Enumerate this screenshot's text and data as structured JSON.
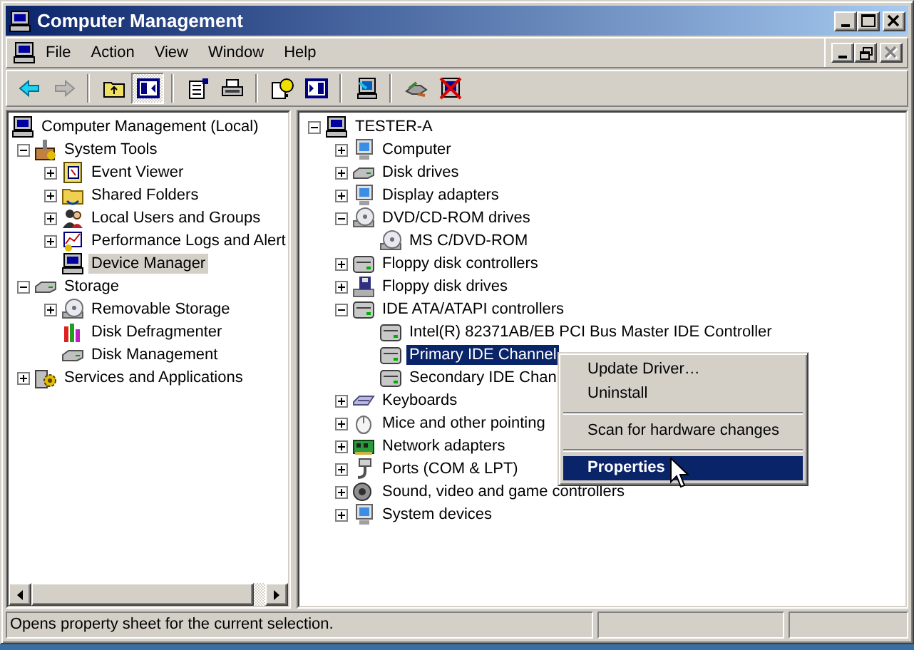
{
  "window": {
    "title": "Computer Management",
    "buttons": [
      {
        "kind": "minimize"
      },
      {
        "kind": "maximize"
      },
      {
        "kind": "close"
      }
    ]
  },
  "menu_bar": {
    "items": [
      "File",
      "Action",
      "View",
      "Window",
      "Help"
    ],
    "child_buttons": [
      {
        "kind": "minimize",
        "disabled": false
      },
      {
        "kind": "restore",
        "disabled": false
      },
      {
        "kind": "close",
        "disabled": true
      }
    ]
  },
  "toolbar": {
    "groups": [
      [
        {
          "pressed": false,
          "disabled": false
        },
        {
          "pressed": false,
          "disabled": true
        }
      ],
      [
        {
          "pressed": false,
          "disabled": false
        },
        {
          "pressed": true,
          "disabled": false
        }
      ],
      [
        {
          "pressed": false,
          "disabled": false
        },
        {
          "pressed": false,
          "disabled": false
        }
      ],
      [
        {
          "pressed": false,
          "disabled": false
        },
        {
          "pressed": false,
          "disabled": false
        }
      ],
      [
        {
          "pressed": false,
          "disabled": false
        }
      ],
      [
        {
          "pressed": false,
          "disabled": false
        },
        {
          "pressed": false,
          "disabled": false
        }
      ]
    ]
  },
  "left_tree": {
    "focused": false,
    "nodes": [
      {
        "label": "Computer Management (Local)",
        "kind": "root",
        "selected": false,
        "children": [
          {
            "label": "System Tools",
            "kind": "branch",
            "expanded": true,
            "selected": false,
            "children": [
              {
                "label": "Event Viewer",
                "kind": "branch",
                "expanded": false,
                "selected": false
              },
              {
                "label": "Shared Folders",
                "kind": "branch",
                "expanded": false,
                "selected": false
              },
              {
                "label": "Local Users and Groups",
                "kind": "branch",
                "expanded": false,
                "selected": false
              },
              {
                "label": "Performance Logs and Alert",
                "kind": "branch",
                "expanded": false,
                "selected": false
              },
              {
                "label": "Device Manager",
                "kind": "leaf",
                "selected": true
              }
            ]
          },
          {
            "label": "Storage",
            "kind": "branch",
            "expanded": true,
            "selected": false,
            "children": [
              {
                "label": "Removable Storage",
                "kind": "branch",
                "expanded": false,
                "selected": false
              },
              {
                "label": "Disk Defragmenter",
                "kind": "leaf",
                "selected": false
              },
              {
                "label": "Disk Management",
                "kind": "leaf",
                "selected": false
              }
            ]
          },
          {
            "label": "Services and Applications",
            "kind": "branch",
            "expanded": false,
            "selected": false
          }
        ]
      }
    ]
  },
  "right_tree": {
    "focused": true,
    "nodes": [
      {
        "label": "TESTER-A",
        "kind": "branch",
        "expanded": true,
        "selected": false,
        "children": [
          {
            "label": "Computer",
            "kind": "branch",
            "expanded": false,
            "selected": false
          },
          {
            "label": "Disk drives",
            "kind": "branch",
            "expanded": false,
            "selected": false
          },
          {
            "label": "Display adapters",
            "kind": "branch",
            "expanded": false,
            "selected": false
          },
          {
            "label": "DVD/CD-ROM drives",
            "kind": "branch",
            "expanded": true,
            "selected": false,
            "children": [
              {
                "label": "MS C/DVD-ROM",
                "kind": "leaf",
                "selected": false
              }
            ]
          },
          {
            "label": "Floppy disk controllers",
            "kind": "branch",
            "expanded": false,
            "selected": false
          },
          {
            "label": "Floppy disk drives",
            "kind": "branch",
            "expanded": false,
            "selected": false
          },
          {
            "label": "IDE ATA/ATAPI controllers",
            "kind": "branch",
            "expanded": true,
            "selected": false,
            "children": [
              {
                "label": "Intel(R) 82371AB/EB PCI Bus Master IDE Controller",
                "kind": "leaf",
                "selected": false
              },
              {
                "label": "Primary IDE Channel",
                "kind": "leaf",
                "selected": true
              },
              {
                "label": "Secondary IDE Chan",
                "kind": "leaf",
                "selected": false
              }
            ]
          },
          {
            "label": "Keyboards",
            "kind": "branch",
            "expanded": false,
            "selected": false
          },
          {
            "label": "Mice and other pointing",
            "kind": "branch",
            "expanded": false,
            "selected": false
          },
          {
            "label": "Network adapters",
            "kind": "branch",
            "expanded": false,
            "selected": false
          },
          {
            "label": "Ports (COM & LPT)",
            "kind": "branch",
            "expanded": false,
            "selected": false
          },
          {
            "label": "Sound, video and game controllers",
            "kind": "branch",
            "expanded": false,
            "selected": false
          },
          {
            "label": "System devices",
            "kind": "branch",
            "expanded": false,
            "selected": false
          }
        ]
      }
    ]
  },
  "context_menu": {
    "items": [
      {
        "kind": "item",
        "label": "Update Driver…",
        "selected": false,
        "default": false
      },
      {
        "kind": "item",
        "label": "Uninstall",
        "selected": false,
        "default": false
      },
      {
        "kind": "separator"
      },
      {
        "kind": "item",
        "label": "Scan for hardware changes",
        "selected": false,
        "default": false
      },
      {
        "kind": "separator"
      },
      {
        "kind": "item",
        "label": "Properties",
        "selected": true,
        "default": true
      }
    ]
  },
  "status_bar": {
    "text": "Opens property sheet for the current selection."
  }
}
